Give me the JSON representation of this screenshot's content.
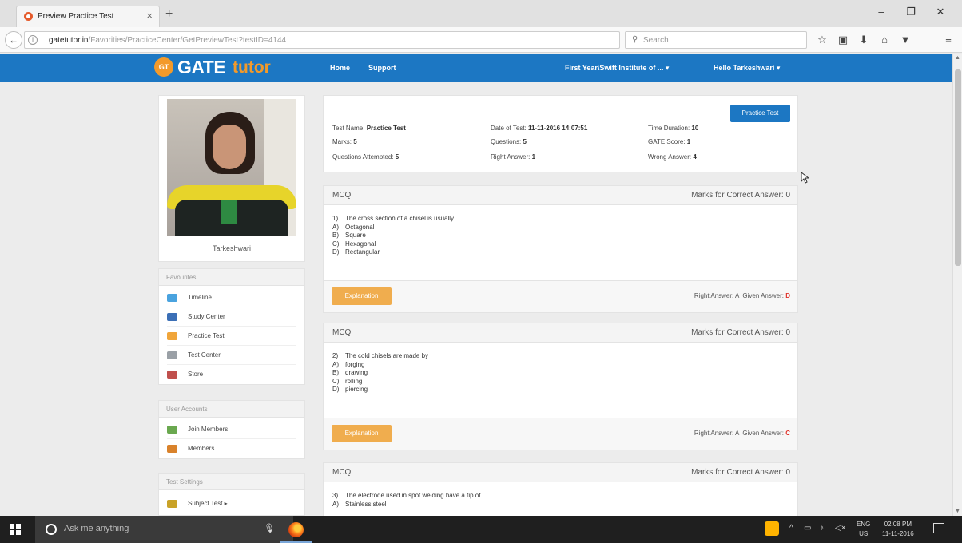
{
  "browser": {
    "tab_title": "Preview Practice Test",
    "tab_close": "×",
    "new_tab": "+",
    "back": "←",
    "info": "i",
    "url_domain": "gatetutor.in",
    "url_path": "/Favorities/PracticeCenter/GetPreviewTest?testID=4144",
    "reload": "C",
    "search_placeholder": "Search",
    "search_glyph": "⚲",
    "toolbar_glyphs": [
      "☆",
      "▣",
      "⬇",
      "⌂",
      "▼",
      "≡"
    ],
    "window_controls": [
      "‒",
      "❐",
      "✕"
    ]
  },
  "site": {
    "logo_badge": "GT",
    "logo_gate": "GATE",
    "logo_tutor": "tutor",
    "nav": {
      "home": "Home",
      "support": "Support",
      "institute": "First Year\\Swift Institute of ... ▾",
      "user": "Hello Tarkeshwari ▾"
    }
  },
  "profile": {
    "name": "Tarkeshwari"
  },
  "sidebar": {
    "favourites": {
      "title": "Favourites",
      "items": [
        {
          "label": "Timeline",
          "icon": "timeline-icon",
          "color": "#4aa3df"
        },
        {
          "label": "Study Center",
          "icon": "study-center-icon",
          "color": "#3b6fb6"
        },
        {
          "label": "Practice Test",
          "icon": "practice-test-icon",
          "color": "#f0a53a"
        },
        {
          "label": "Test Center",
          "icon": "test-center-icon",
          "color": "#9aa0a6"
        },
        {
          "label": "Store",
          "icon": "store-icon",
          "color": "#c0504d"
        }
      ]
    },
    "user_accounts": {
      "title": "User Accounts",
      "items": [
        {
          "label": "Join Members",
          "icon": "join-members-icon",
          "color": "#6aa84f"
        },
        {
          "label": "Members",
          "icon": "members-icon",
          "color": "#d9822b"
        }
      ]
    },
    "test_settings": {
      "title": "Test Settings",
      "items": [
        {
          "label": "Subject Test ▸",
          "icon": "subject-test-icon",
          "color": "#c9a227"
        }
      ]
    }
  },
  "summary": {
    "practice_button": "Practice Test",
    "col1": [
      {
        "label": "Test Name:",
        "value": "Practice Test"
      },
      {
        "label": "Marks:",
        "value": "5"
      },
      {
        "label": "Questions Attempted:",
        "value": "5"
      }
    ],
    "col2": [
      {
        "label": "Date of Test:",
        "value": "11-11-2016 14:07:51"
      },
      {
        "label": "Questions:",
        "value": "5"
      },
      {
        "label": "Right Answer:",
        "value": "1"
      }
    ],
    "col3": [
      {
        "label": "Time Duration:",
        "value": "10"
      },
      {
        "label": "GATE Score:",
        "value": "1"
      },
      {
        "label": "Wrong Answer:",
        "value": "4"
      }
    ]
  },
  "questions": [
    {
      "type": "MCQ",
      "marks_label": "Marks for Correct Answer: 0",
      "lines": [
        {
          "k": "1)",
          "t": "The cross section of a chisel is usually"
        },
        {
          "k": "A)",
          "t": "Octagonal"
        },
        {
          "k": "B)",
          "t": "Square"
        },
        {
          "k": "C)",
          "t": "Hexagonal"
        },
        {
          "k": "D)",
          "t": "Rectangular"
        }
      ],
      "explanation": "Explanation",
      "right_label": "Right Answer:",
      "right_value": "A",
      "given_label": "Given Answer:",
      "given_value": "D"
    },
    {
      "type": "MCQ",
      "marks_label": "Marks for Correct Answer: 0",
      "lines": [
        {
          "k": "2)",
          "t": "The cold chisels are made by"
        },
        {
          "k": "A)",
          "t": "forging"
        },
        {
          "k": "B)",
          "t": "drawing"
        },
        {
          "k": "C)",
          "t": "rolling"
        },
        {
          "k": "D)",
          "t": "piercing"
        }
      ],
      "explanation": "Explanation",
      "right_label": "Right Answer:",
      "right_value": "A",
      "given_label": "Given Answer:",
      "given_value": "C"
    },
    {
      "type": "MCQ",
      "marks_label": "Marks for Correct Answer: 0",
      "lines": [
        {
          "k": "3)",
          "t": "The electrode used in spot welding have a tip of"
        },
        {
          "k": "A)",
          "t": "Stainless steel"
        }
      ]
    }
  ],
  "taskbar": {
    "search_placeholder": "Ask me anything",
    "mic": "🎙",
    "tray": [
      "^",
      "▭",
      "♪",
      "◁×"
    ],
    "lang_top": "ENG",
    "lang_bottom": "US",
    "time": "02:08 PM",
    "date": "11-11-2016"
  }
}
